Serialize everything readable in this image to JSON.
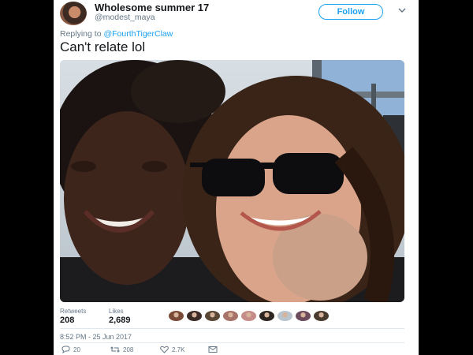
{
  "tweet": {
    "display_name": "Wholesome summer 17",
    "handle": "@modest_maya",
    "follow_label": "Follow",
    "reply_prefix": "Replying to",
    "reply_to": "@FourthTigerClaw",
    "text": "Can't relate lol",
    "retweets_label": "Retweets",
    "retweets_count": "208",
    "likes_label": "Likes",
    "likes_count": "2,689",
    "timestamp": "8:52 PM - 25 Jun 2017"
  },
  "actions": {
    "reply_count": "20",
    "retweet_count": "208",
    "like_count": "2.7K"
  },
  "liker_avatar_colors": [
    "#7a4a36",
    "#3b2b26",
    "#5a4634",
    "#a7726a",
    "#c58c89",
    "#2e2522",
    "#b9c4cc",
    "#6c4b5c",
    "#4a3b2f"
  ],
  "icons": [
    "chevron-down-icon",
    "reply-icon",
    "retweet-icon",
    "heart-icon",
    "message-icon"
  ],
  "colors": {
    "accent": "#1da1f2",
    "muted": "#657786",
    "text": "#14171a"
  }
}
